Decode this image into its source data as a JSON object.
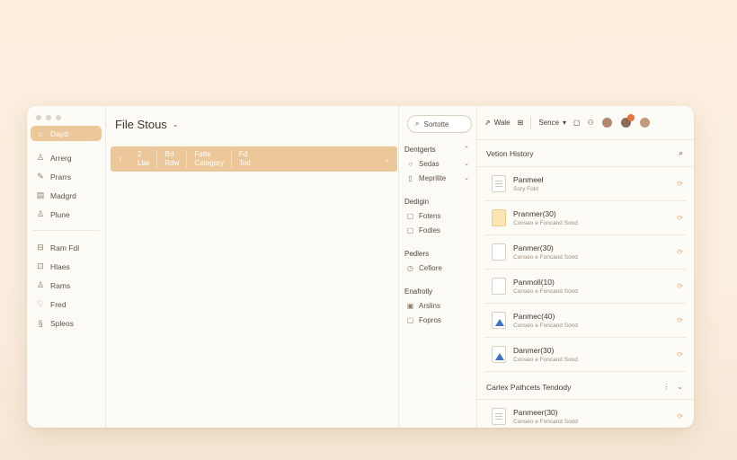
{
  "sidebar": {
    "items": [
      {
        "icon": "⌂",
        "label": "Dayd"
      },
      {
        "icon": "♙",
        "label": "Arrerg"
      },
      {
        "icon": "✎",
        "label": "Prarrs"
      },
      {
        "icon": "▤",
        "label": "Madgrd"
      },
      {
        "icon": "♙",
        "label": "Plune"
      }
    ],
    "items2": [
      {
        "icon": "⊟",
        "label": "Ram Fdl"
      },
      {
        "icon": "⊡",
        "label": "Hlaes"
      },
      {
        "icon": "♙",
        "label": "Rams"
      },
      {
        "icon": "♡",
        "label": "Fred"
      },
      {
        "icon": "§",
        "label": "Spleos"
      }
    ]
  },
  "filepane": {
    "title": "File Stous",
    "columns": [
      {
        "top": "2",
        "bottom": "Lbe"
      },
      {
        "top": "Bd",
        "bottom": "Rdw"
      },
      {
        "top": "Fatte",
        "bottom": "Category"
      },
      {
        "top": "Fd",
        "bottom": "Tod"
      }
    ]
  },
  "filters": {
    "search_label": "Sortotte",
    "groups": [
      {
        "title": "Dentgerts",
        "items": [
          {
            "icon": "○",
            "label": "Sedas",
            "chevron": true
          },
          {
            "icon": "▯",
            "label": "Meprilite",
            "chevron": true
          }
        ]
      },
      {
        "title": "Dedigin",
        "items": [
          {
            "icon": "▢",
            "label": "Fotens",
            "chevron": false
          },
          {
            "icon": "▢",
            "label": "Fodies",
            "chevron": false
          }
        ]
      },
      {
        "title": "Pedlers",
        "items": [
          {
            "icon": "◷",
            "label": "Cefiore",
            "chevron": false
          }
        ]
      },
      {
        "title": "Enafrolly",
        "items": [
          {
            "icon": "▣",
            "label": "Arslins",
            "chevron": false
          },
          {
            "icon": "▢",
            "label": "Fopros",
            "chevron": false
          }
        ]
      }
    ]
  },
  "toolbar": {
    "share_label": "Wale",
    "service_label": "Sence"
  },
  "version_history": {
    "title": "Vetion History",
    "items": [
      {
        "doc": "lines",
        "name": "Panmeel",
        "sub": "Sory Fold"
      },
      {
        "doc": "yellow",
        "name": "Pranmer(30)",
        "sub": "Conseo e Foncand Sond"
      },
      {
        "doc": "plain",
        "name": "Panmer(30)",
        "sub": "Conseo e Foncand Sond"
      },
      {
        "doc": "plain",
        "name": "Panmoll(10)",
        "sub": "Conseo e Foncand Sond"
      },
      {
        "doc": "tri",
        "name": "Panmec(40)",
        "sub": "Conseo e Foncand Sond"
      },
      {
        "doc": "tri",
        "name": "Danmer(30)",
        "sub": "Conseo e Foncand Sond"
      }
    ]
  },
  "recent": {
    "title": "Carlex Pathcets Tendody",
    "items": [
      {
        "doc": "lines",
        "name": "Panmeer(30)",
        "sub": "Conseo e Foncand Sond"
      }
    ]
  },
  "colors": {
    "accent": "#ecc79a",
    "badge": "#e9743f"
  }
}
